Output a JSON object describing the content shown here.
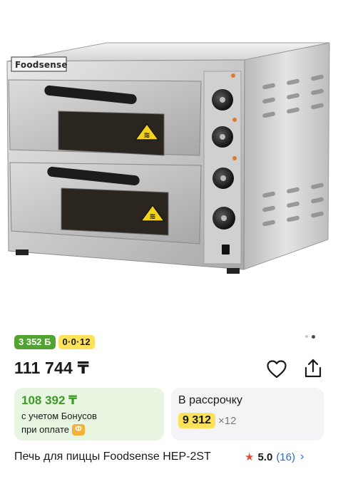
{
  "product": {
    "brand_logo": "Foodsense",
    "title": "Печь для пиццы Foodsense HEP-2ST",
    "price": "111 744 ₸",
    "rating_score": "5.0",
    "reviews_count": "(16)"
  },
  "badges": {
    "bonus": "3 352 Б",
    "installment": "0·0·12"
  },
  "bonus_card": {
    "price": "108 392 ₸",
    "line1": "с учетом Бонусов",
    "line2": "при оплате",
    "bank_icon_letter": "Ф"
  },
  "credit_card": {
    "title": "В рассрочку",
    "amount": "9 312",
    "months": "×12"
  },
  "gallery": {
    "slides": 2,
    "active_slide": 1
  },
  "colors": {
    "bonus_green": "#52a331",
    "installment_yellow": "#fbe25a",
    "rating_star": "#e74c3c",
    "link_blue": "#2d6bd3"
  },
  "icons": {
    "favorite": "heart-icon",
    "share": "share-icon",
    "rating": "star-icon",
    "more": "chevron-right-icon"
  }
}
